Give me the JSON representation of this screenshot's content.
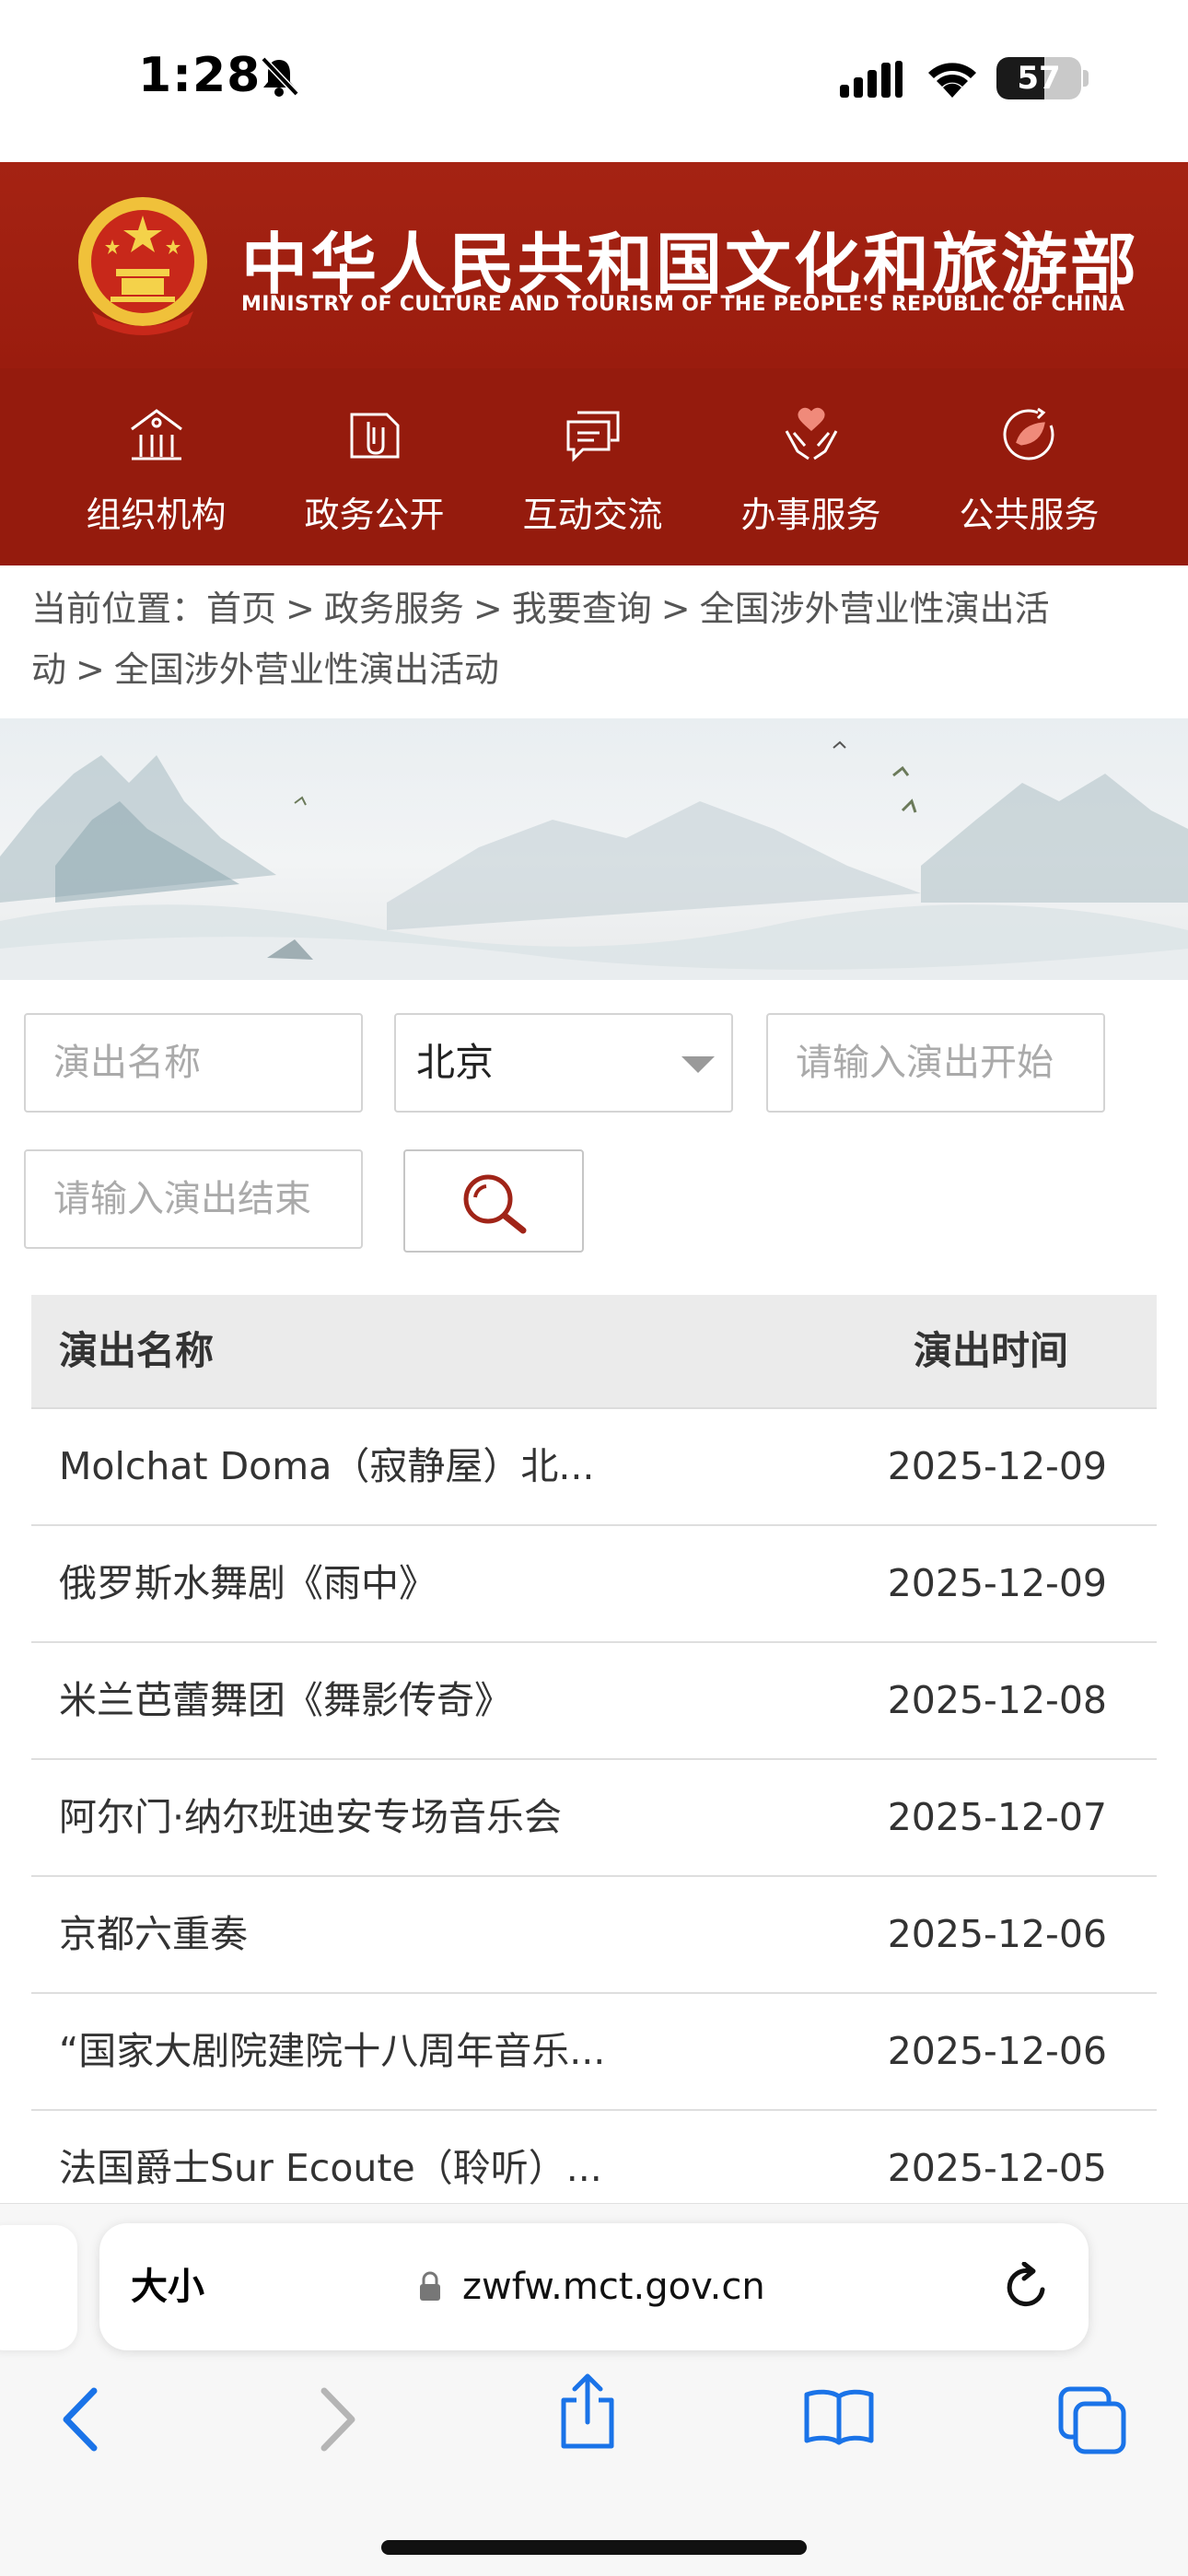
{
  "status_bar": {
    "time": "1:28",
    "battery": "57",
    "battery_level": 0.57
  },
  "header": {
    "title_cn": "中华人民共和国文化和旅游部",
    "title_en": "MINISTRY OF CULTURE AND TOURISM OF THE PEOPLE'S REPUBLIC OF CHINA"
  },
  "nav": {
    "items": [
      {
        "label": "组织机构",
        "icon": "building-icon"
      },
      {
        "label": "政务公开",
        "icon": "document-icon"
      },
      {
        "label": "互动交流",
        "icon": "chat-icon"
      },
      {
        "label": "办事服务",
        "icon": "heart-hands-icon"
      },
      {
        "label": "公共服务",
        "icon": "leaf-circle-icon"
      }
    ]
  },
  "breadcrumb": {
    "prefix": "当前位置：",
    "items": [
      "首页",
      "政务服务",
      "我要查询",
      "全国涉外营业性演出活动",
      "全国涉外营业性演出活动"
    ],
    "separator": ">"
  },
  "search": {
    "name_placeholder": "演出名称",
    "city": "北京",
    "start_placeholder": "请输入演出开始",
    "end_placeholder": "请输入演出结束"
  },
  "table": {
    "headers": {
      "name": "演出名称",
      "time": "演出时间"
    },
    "rows": [
      {
        "name": "Molchat Doma（寂静屋）北...",
        "date": "2025-12-09"
      },
      {
        "name": "俄罗斯水舞剧《雨中》",
        "date": "2025-12-09"
      },
      {
        "name": "米兰芭蕾舞团《舞影传奇》",
        "date": "2025-12-08"
      },
      {
        "name": "阿尔门·纳尔班迪安专场音乐会",
        "date": "2025-12-07"
      },
      {
        "name": "京都六重奏",
        "date": "2025-12-06"
      },
      {
        "name": "“国家大剧院建院十八周年音乐...",
        "date": "2025-12-06"
      },
      {
        "name": "法国爵士Sur Ecoute（聆听）...",
        "date": "2025-12-05"
      }
    ]
  },
  "browser": {
    "text_size": "大小",
    "url": "zwfw.mct.gov.cn"
  },
  "colors": {
    "brand_red": "#9a1c0e",
    "nav_red": "#951b0d"
  }
}
